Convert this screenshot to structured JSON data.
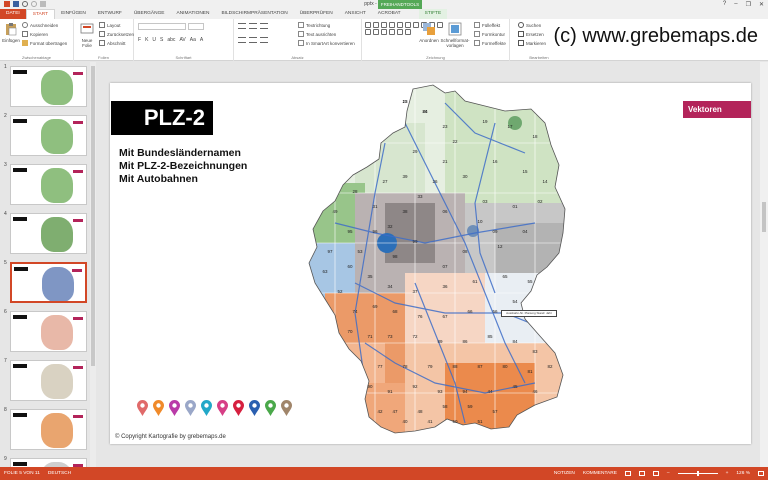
{
  "window": {
    "title": "pptx - PowerPoint",
    "context_title": "FREIHANDTOOLS",
    "controls": [
      "?",
      "–",
      "❐",
      "✕"
    ]
  },
  "tabs": [
    {
      "label": "DATEI",
      "kind": "file"
    },
    {
      "label": "START",
      "kind": "active"
    },
    {
      "label": "EINFÜGEN",
      "kind": ""
    },
    {
      "label": "ENTWURF",
      "kind": ""
    },
    {
      "label": "ÜBERGÄNGE",
      "kind": ""
    },
    {
      "label": "ANIMATIONEN",
      "kind": ""
    },
    {
      "label": "BILDSCHIRMPRÄSENTATION",
      "kind": ""
    },
    {
      "label": "ÜBERPRÜFEN",
      "kind": ""
    },
    {
      "label": "ANSICHT",
      "kind": ""
    },
    {
      "label": "ACROBAT",
      "kind": ""
    },
    {
      "label": "STIFTE",
      "kind": "ctx"
    }
  ],
  "ribbon": {
    "clipboard": {
      "paste": "Einfügen",
      "cut": "Ausschneiden",
      "copy": "Kopieren",
      "format_painter": "Format übertragen",
      "group": "Zwischenablage"
    },
    "slides": {
      "new_slide": "Neue Folie",
      "layout": "Layout",
      "reset": "Zurücksetzen",
      "section": "Abschnitt",
      "group": "Folien"
    },
    "font": {
      "group": "Schriftart",
      "buttons": [
        "F",
        "K",
        "U",
        "S",
        "abc",
        "AV",
        "Aa",
        "A"
      ]
    },
    "paragraph": {
      "direction": "Textrichtung",
      "align_text": "Text ausrichten",
      "smartart": "In SmartArt konvertieren",
      "group": "Absatz"
    },
    "drawing": {
      "arrange": "Anordnen",
      "quick_styles": "Schnellformat-vorlagen",
      "fill": "Fülleffekt",
      "outline": "Formkontur",
      "effects": "Formeffekte",
      "group": "Zeichnung"
    },
    "editing": {
      "find": "Suchen",
      "replace": "Ersetzen",
      "select": "Markieren",
      "group": "Bearbeiten"
    }
  },
  "watermark": "(c) www.grebemaps.de",
  "thumbnails": [
    {
      "num": "1",
      "map_color": "#8fbf7f",
      "selected": false
    },
    {
      "num": "2",
      "map_color": "#8fbf7f",
      "selected": false
    },
    {
      "num": "3",
      "map_color": "#8fbf7f",
      "selected": false
    },
    {
      "num": "4",
      "map_color": "#7fae70",
      "selected": false
    },
    {
      "num": "5",
      "map_color": "#7f96c4",
      "selected": true
    },
    {
      "num": "6",
      "map_color": "#e8b8a8",
      "selected": false
    },
    {
      "num": "7",
      "map_color": "#d9d2c2",
      "selected": false
    },
    {
      "num": "8",
      "map_color": "#e9a56f",
      "selected": false
    },
    {
      "num": "9",
      "map_color": "#cfcfcf",
      "selected": false
    }
  ],
  "slide": {
    "title": "PLZ-2",
    "features": [
      "Mit Bundesländernamen",
      "Mit PLZ-2-Bezeichnungen",
      "Mit Autobahnen"
    ],
    "badge": "Vektoren",
    "copyright": "© Copyright Kartografie by grebemaps.de",
    "pin_colors": [
      "#e06a6a",
      "#f08a2a",
      "#b93aa8",
      "#9aa7c8",
      "#22a8c8",
      "#d63f86",
      "#d6203f",
      "#2a5fb0",
      "#4aa84a",
      "#a0856a"
    ],
    "map_labels": [
      "25",
      "24",
      "23",
      "22",
      "19",
      "17",
      "18",
      "29",
      "21",
      "39",
      "16",
      "15",
      "14",
      "26",
      "27",
      "28",
      "49",
      "31",
      "38",
      "06",
      "03",
      "01",
      "02",
      "04",
      "09",
      "08",
      "07",
      "99",
      "98",
      "96",
      "95",
      "97",
      "63",
      "60",
      "35",
      "34",
      "37",
      "36",
      "61",
      "65",
      "55",
      "54",
      "56",
      "66",
      "67",
      "76",
      "68",
      "69",
      "74",
      "70",
      "71",
      "73",
      "72",
      "89",
      "86",
      "85",
      "84",
      "83",
      "82",
      "81",
      "80",
      "87",
      "88",
      "79",
      "78",
      "77",
      "90",
      "91",
      "92",
      "93",
      "94",
      "44",
      "45",
      "46",
      "47",
      "48",
      "58",
      "59",
      "57",
      "42",
      "40",
      "41",
      "50",
      "51",
      "52",
      "53",
      "32",
      "33",
      "30",
      "10",
      "12",
      "13",
      "86"
    ],
    "legend_box": "Autobahn-Nr. Planung Stand: Jahr"
  },
  "status": {
    "slide_of": "FOLIE 5 VON 11",
    "language": "DEUTSCH",
    "notes": "NOTIZEN",
    "comments": "KOMMENTARE",
    "zoom": "126 %"
  }
}
